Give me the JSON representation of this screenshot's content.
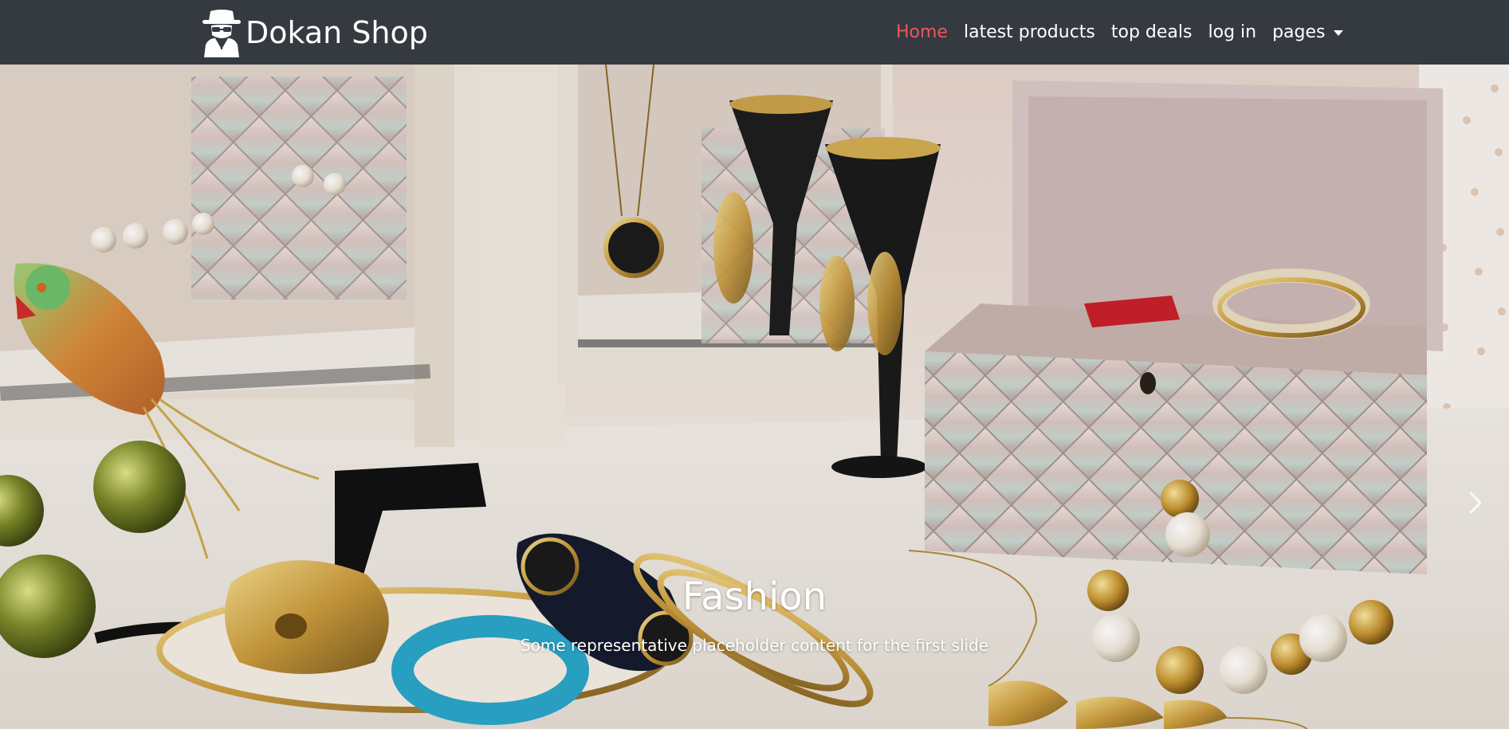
{
  "brand": {
    "name": "Dokan Shop",
    "logo_icon": "spy-agent-icon"
  },
  "nav": {
    "items": [
      {
        "label": "Home",
        "active": true
      },
      {
        "label": "latest products",
        "active": false
      },
      {
        "label": "top deals",
        "active": false
      },
      {
        "label": "log in",
        "active": false
      }
    ],
    "dropdown": {
      "label": "pages",
      "icon": "caret-down-icon"
    }
  },
  "carousel": {
    "slide": {
      "title": "Fashion",
      "text": "Some representative placeholder content for the first slide"
    },
    "next_icon": "chevron-right-icon"
  },
  "colors": {
    "navbar_bg": "#343a40",
    "nav_active": "#e8595f",
    "nav_text": "#ffffff"
  }
}
